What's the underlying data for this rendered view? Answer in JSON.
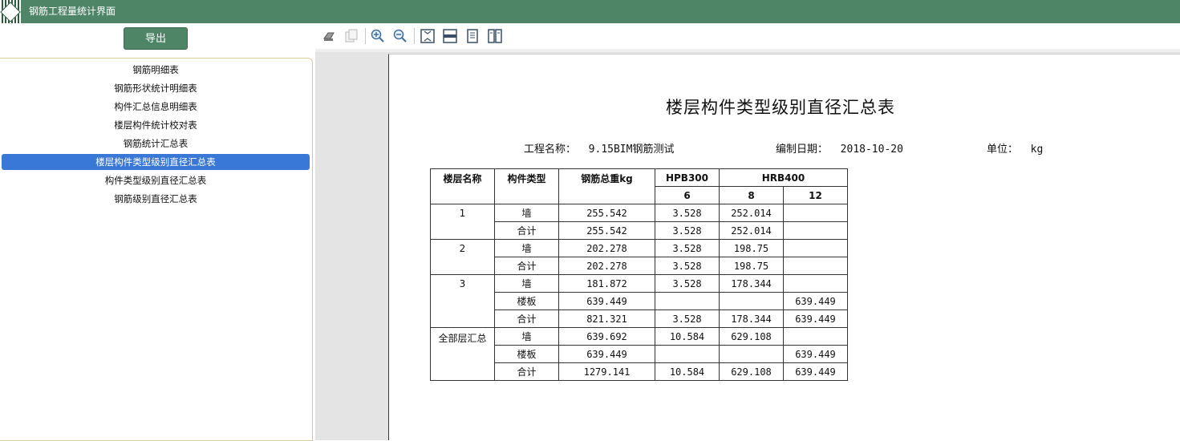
{
  "window": {
    "title": "钢筋工程量统计界面"
  },
  "sidebar": {
    "export_label": "导出",
    "reports": [
      "钢筋明细表",
      "钢筋形状统计明细表",
      "构件汇总信息明细表",
      "楼层构件统计校对表",
      "钢筋统计汇总表",
      "楼层构件类型级别直径汇总表",
      "构件类型级别直径汇总表",
      "钢筋级别直径汇总表"
    ],
    "selected_index": 5
  },
  "toolbar": {
    "buttons": [
      "print-icon",
      "copy-icon",
      "zoom-in-icon",
      "zoom-out-icon",
      "fit-page-icon",
      "fit-width-icon",
      "single-page-icon",
      "two-page-icon"
    ]
  },
  "report": {
    "title": "楼层构件类型级别直径汇总表",
    "project_label": "工程名称：",
    "project_name": "9.15BIM钢筋测试",
    "date_label": "编制日期：",
    "date": "2018-10-20",
    "unit_label": "单位：",
    "unit": "kg",
    "headers": {
      "floor": "楼层名称",
      "type": "构件类型",
      "total": "钢筋总重kg",
      "grade1": "HPB300",
      "grade2": "HRB400",
      "d6": "6",
      "d8": "8",
      "d12": "12"
    },
    "groups": [
      {
        "floor": "1",
        "rows": [
          {
            "type": "墙",
            "total": "255.542",
            "d6": "3.528",
            "d8": "252.014",
            "d12": ""
          },
          {
            "type": "合计",
            "total": "255.542",
            "d6": "3.528",
            "d8": "252.014",
            "d12": ""
          }
        ]
      },
      {
        "floor": "2",
        "rows": [
          {
            "type": "墙",
            "total": "202.278",
            "d6": "3.528",
            "d8": "198.75",
            "d12": ""
          },
          {
            "type": "合计",
            "total": "202.278",
            "d6": "3.528",
            "d8": "198.75",
            "d12": ""
          }
        ]
      },
      {
        "floor": "3",
        "rows": [
          {
            "type": "墙",
            "total": "181.872",
            "d6": "3.528",
            "d8": "178.344",
            "d12": ""
          },
          {
            "type": "楼板",
            "total": "639.449",
            "d6": "",
            "d8": "",
            "d12": "639.449"
          },
          {
            "type": "合计",
            "total": "821.321",
            "d6": "3.528",
            "d8": "178.344",
            "d12": "639.449"
          }
        ]
      },
      {
        "floor": "全部层汇总",
        "rows": [
          {
            "type": "墙",
            "total": "639.692",
            "d6": "10.584",
            "d8": "629.108",
            "d12": ""
          },
          {
            "type": "楼板",
            "total": "639.449",
            "d6": "",
            "d8": "",
            "d12": "639.449"
          },
          {
            "type": "合计",
            "total": "1279.141",
            "d6": "10.584",
            "d8": "629.108",
            "d12": "639.449"
          }
        ]
      }
    ]
  }
}
